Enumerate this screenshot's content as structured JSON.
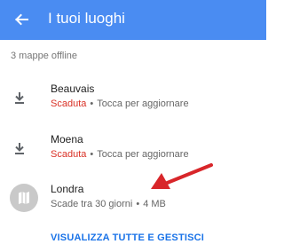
{
  "header": {
    "title": "I tuoi luoghi",
    "back_icon": "back-arrow-icon",
    "background_color": "#4a8cf2"
  },
  "summary": {
    "count_text": "3 mappe offline"
  },
  "maps": [
    {
      "name": "Beauvais",
      "status": "Scaduta",
      "separator": "•",
      "detail": "Tocca per aggiornare",
      "icon": "download-icon"
    },
    {
      "name": "Moena",
      "status": "Scaduta",
      "separator": "•",
      "detail": "Tocca per aggiornare",
      "icon": "download-icon"
    },
    {
      "name": "Londra",
      "status": "Scade tra 30 giorni",
      "separator": "•",
      "detail": "4 MB",
      "icon": "map-icon"
    }
  ],
  "footer": {
    "action_label": "VISUALIZZA TUTTE E GESTISCI"
  },
  "colors": {
    "status_expired": "#d93025",
    "link": "#1a73e8",
    "annotation_arrow": "#d8262a"
  }
}
